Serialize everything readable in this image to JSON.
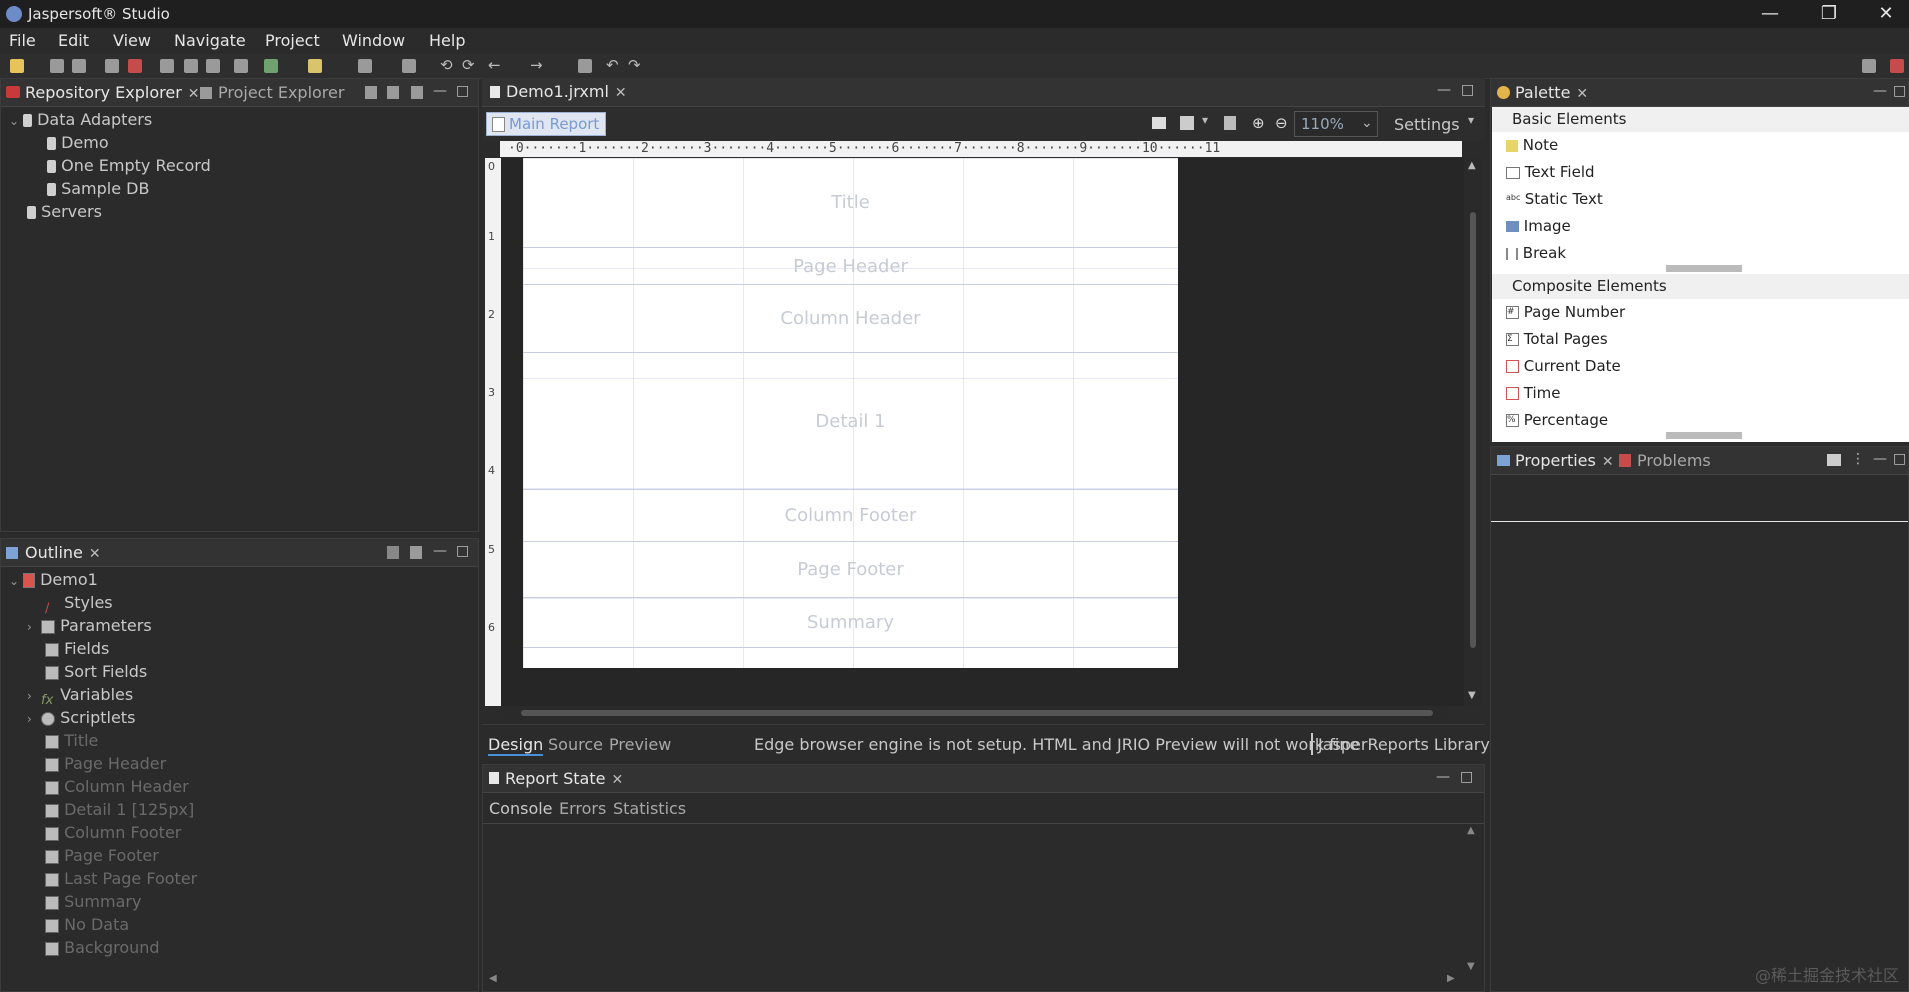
{
  "window": {
    "title": "Jaspersoft® Studio",
    "min": "—",
    "max": "❐",
    "close": "✕"
  },
  "menu": [
    "File",
    "Edit",
    "View",
    "Navigate",
    "Project",
    "Window",
    "Help"
  ],
  "left_top": {
    "tabs": [
      {
        "label": "Repository Explorer",
        "close": "✕"
      },
      {
        "label": "Project Explorer"
      }
    ],
    "tree": [
      {
        "label": "Data Adapters",
        "level": 0,
        "expanded": true
      },
      {
        "label": "Demo",
        "level": 1
      },
      {
        "label": "One Empty Record",
        "level": 1
      },
      {
        "label": "Sample DB",
        "level": 1
      },
      {
        "label": "Servers",
        "level": 0
      }
    ]
  },
  "outline": {
    "tab": "Outline",
    "close": "✕",
    "tree": [
      {
        "label": "Demo1",
        "level": 0,
        "expanded": true,
        "dim": false
      },
      {
        "label": "Styles",
        "level": 1,
        "dim": false
      },
      {
        "label": "Parameters",
        "level": 1,
        "collapsed": true,
        "dim": false
      },
      {
        "label": "Fields",
        "level": 1,
        "dim": false
      },
      {
        "label": "Sort Fields",
        "level": 1,
        "dim": false
      },
      {
        "label": "Variables",
        "level": 1,
        "collapsed": true,
        "dim": false
      },
      {
        "label": "Scriptlets",
        "level": 1,
        "collapsed": true,
        "dim": false
      },
      {
        "label": "Title",
        "level": 1,
        "dim": true
      },
      {
        "label": "Page Header",
        "level": 1,
        "dim": true
      },
      {
        "label": "Column Header",
        "level": 1,
        "dim": true
      },
      {
        "label": "Detail 1 [125px]",
        "level": 1,
        "dim": true
      },
      {
        "label": "Column Footer",
        "level": 1,
        "dim": true
      },
      {
        "label": "Page Footer",
        "level": 1,
        "dim": true
      },
      {
        "label": "Last Page Footer",
        "level": 1,
        "dim": true
      },
      {
        "label": "Summary",
        "level": 1,
        "dim": true
      },
      {
        "label": "No Data",
        "level": 1,
        "dim": true
      },
      {
        "label": "Background",
        "level": 1,
        "dim": true
      }
    ]
  },
  "editor": {
    "tab": "Demo1.jrxml",
    "close": "✕",
    "main_report": "Main Report",
    "zoom": "110%",
    "settings": "Settings",
    "ruler_h": "·0·······1·······2·······3·······4·······5·······6·······7·······8·······9·······10······11",
    "ruler_v": [
      "0",
      "1",
      "2",
      "3",
      "4",
      "5",
      "6"
    ],
    "bands": [
      "Title",
      "Page Header",
      "Column Header",
      "Detail 1",
      "Column Footer",
      "Page Footer",
      "Summary"
    ],
    "bottom_tabs": [
      "Design",
      "Source",
      "Preview"
    ],
    "status": "Edge browser engine is not setup. HTML and JRIO Preview will not work fine",
    "library": "JasperReports Library"
  },
  "report_state": {
    "tab": "Report State",
    "close": "✕",
    "subtabs": [
      "Console",
      "Errors",
      "Statistics"
    ]
  },
  "palette": {
    "tab": "Palette",
    "close": "✕",
    "basic_title": "Basic Elements",
    "basic": [
      "Note",
      "Text Field",
      "Static Text",
      "Image",
      "Break"
    ],
    "composite_title": "Composite Elements",
    "composite": [
      "Page Number",
      "Total Pages",
      "Current Date",
      "Time",
      "Percentage"
    ]
  },
  "properties": {
    "tab": "Properties",
    "close": "✕",
    "problems": "Problems"
  },
  "watermark": "@稀土掘金技术社区"
}
